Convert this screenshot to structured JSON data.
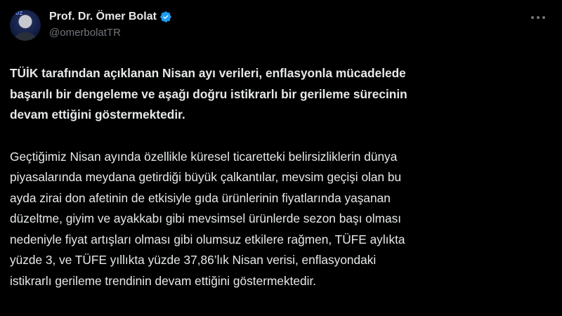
{
  "author": {
    "display_name": "Prof. Dr. Ömer Bolat",
    "handle": "@omerbolatTR",
    "avatar_text": "YÜZ",
    "verified_color": "#1d9bf0"
  },
  "post": {
    "paragraph_1": "TÜİK tarafından açıklanan Nisan ayı verileri, enflasyonla mücadelede\nbaşarılı bir dengeleme ve aşağı doğru istikrarlı bir gerileme sürecinin\ndevam ettiğini göstermektedir.",
    "paragraph_2": "Geçtiğimiz Nisan ayında özellikle küresel ticaretteki belirsizliklerin dünya\npiyasalarında meydana getirdiği büyük çalkantılar, mevsim geçişi olan bu\nayda zirai don afetinin de etkisiyle gıda ürünlerinin fiyatlarında yaşanan\ndüzeltme, giyim ve ayakkabı gibi mevsimsel ürünlerde sezon başı olması\nnedeniyle fiyat artışları olması gibi olumsuz etkilere rağmen, TÜFE aylıkta\nyüzde 3, ve TÜFE yıllıkta yüzde 37,86’lık Nisan verisi, enflasyondaki\nistikrarlı gerileme trendinin devam ettiğini göstermektedir."
  },
  "icons": {
    "more": "more-options-icon",
    "verified": "verified-badge-icon"
  },
  "colors": {
    "background": "#000000",
    "text": "#e7e9ea",
    "secondary_text": "#71767b"
  }
}
